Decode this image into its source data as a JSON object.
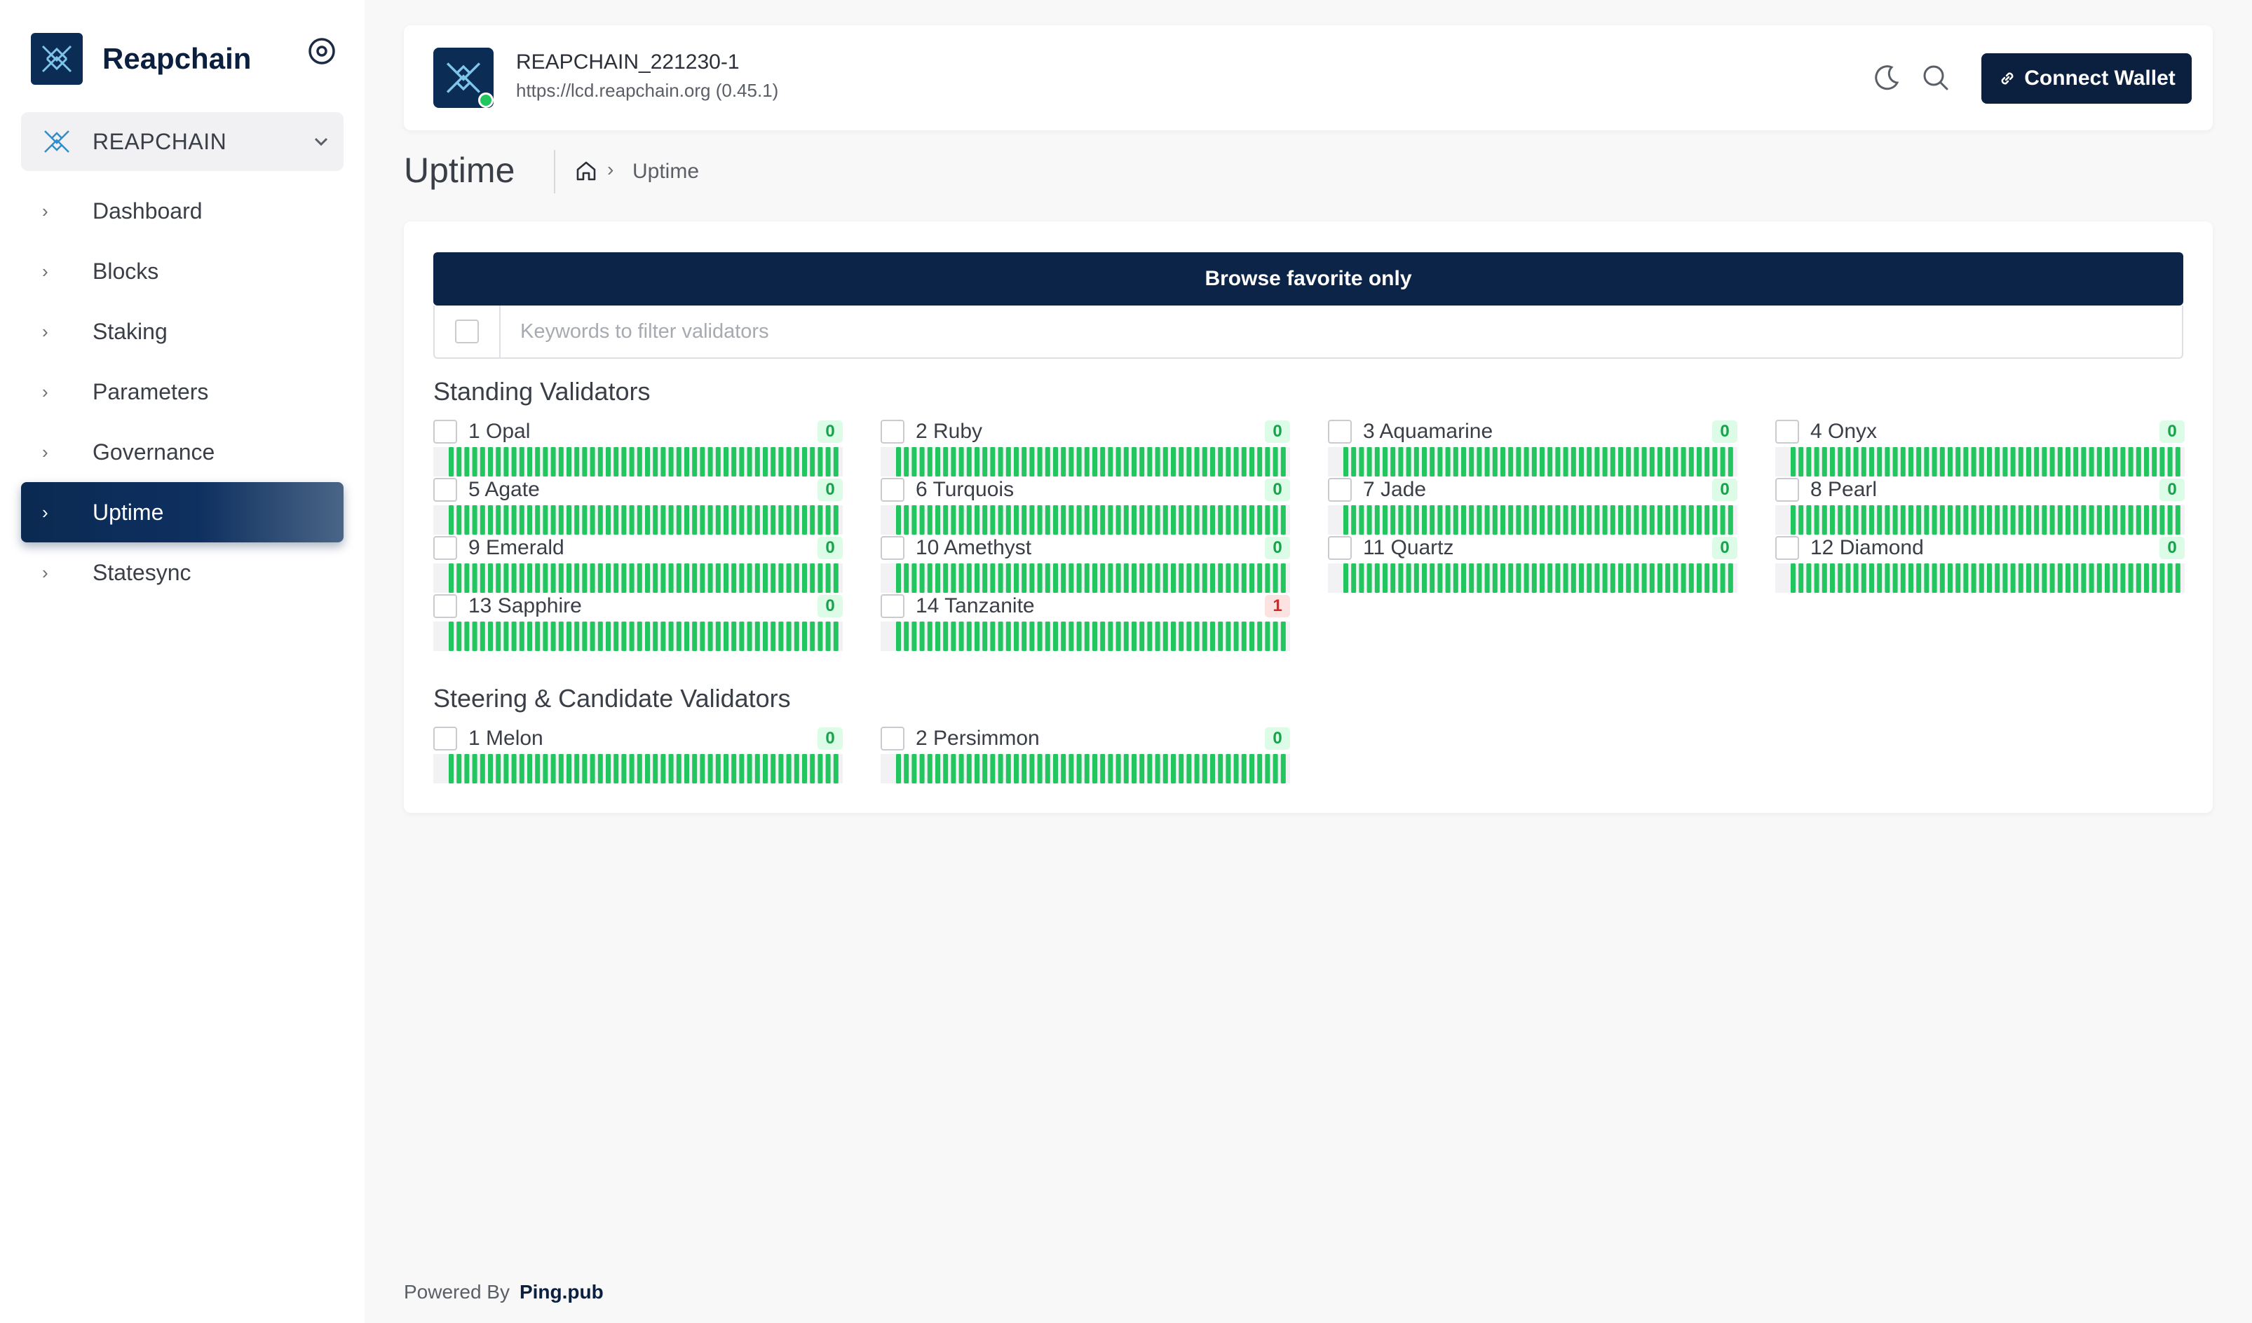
{
  "app": {
    "brand": "Reapchain",
    "network": "REAPCHAIN",
    "colors": {
      "primary": "#0b1f3e",
      "success": "#22c55e",
      "danger": "#dc2626"
    }
  },
  "sidebar": {
    "items": [
      {
        "label": "Dashboard",
        "active": false
      },
      {
        "label": "Blocks",
        "active": false
      },
      {
        "label": "Staking",
        "active": false
      },
      {
        "label": "Parameters",
        "active": false
      },
      {
        "label": "Governance",
        "active": false
      },
      {
        "label": "Uptime",
        "active": true
      },
      {
        "label": "Statesync",
        "active": false
      }
    ]
  },
  "topbar": {
    "chain_id": "REAPCHAIN_221230-1",
    "endpoint": "https://lcd.reapchain.org (0.45.1)",
    "connect_label": "Connect Wallet"
  },
  "page": {
    "title": "Uptime",
    "breadcrumb_current": "Uptime"
  },
  "main": {
    "favorite_button": "Browse favorite only",
    "filter_placeholder": "Keywords to filter validators",
    "standing_title": "Standing Validators",
    "steering_title": "Steering & Candidate Validators",
    "standing": [
      {
        "name": "1 Opal",
        "missed": "0"
      },
      {
        "name": "2 Ruby",
        "missed": "0"
      },
      {
        "name": "3 Aquamarine",
        "missed": "0"
      },
      {
        "name": "4 Onyx",
        "missed": "0"
      },
      {
        "name": "5 Agate",
        "missed": "0"
      },
      {
        "name": "6 Turquois",
        "missed": "0"
      },
      {
        "name": "7 Jade",
        "missed": "0"
      },
      {
        "name": "8 Pearl",
        "missed": "0"
      },
      {
        "name": "9 Emerald",
        "missed": "0"
      },
      {
        "name": "10 Amethyst",
        "missed": "0"
      },
      {
        "name": "11 Quartz",
        "missed": "0"
      },
      {
        "name": "12 Diamond",
        "missed": "0"
      },
      {
        "name": "13 Sapphire",
        "missed": "0"
      },
      {
        "name": "14 Tanzanite",
        "missed": "1"
      }
    ],
    "steering": [
      {
        "name": "1 Melon",
        "missed": "0"
      },
      {
        "name": "2 Persimmon",
        "missed": "0"
      }
    ]
  },
  "footer": {
    "prefix": "Powered By",
    "brand": "Ping.pub"
  }
}
